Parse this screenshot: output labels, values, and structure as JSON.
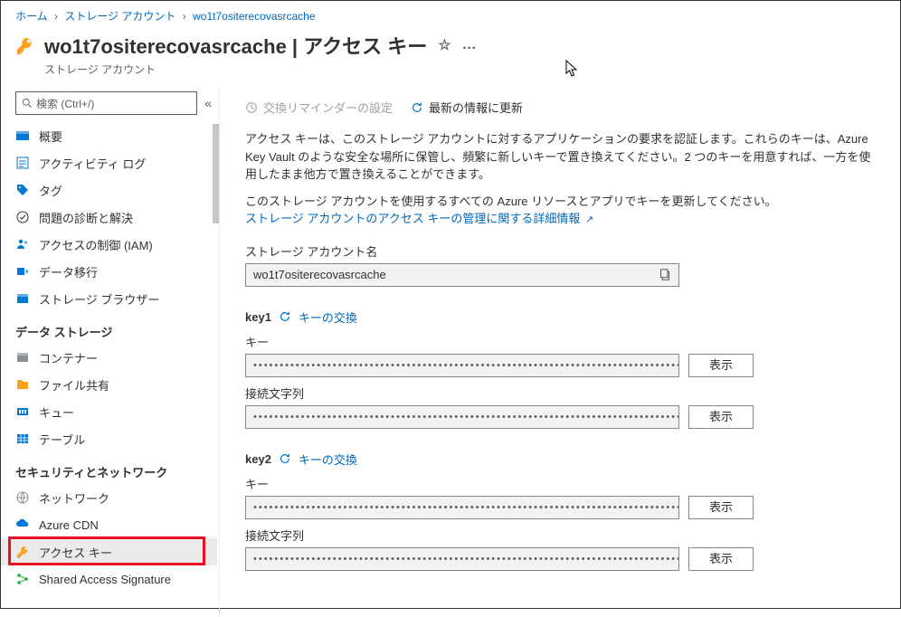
{
  "breadcrumb": {
    "home": "ホーム",
    "storage_accounts": "ストレージ アカウント",
    "current": "wo1t7ositerecovasrcache"
  },
  "header": {
    "title": "wo1t7ositerecovasrcache | アクセス キー",
    "subtitle": "ストレージ アカウント",
    "star": "☆",
    "more": "…"
  },
  "search": {
    "placeholder": "検索 (Ctrl+/)"
  },
  "nav": {
    "items": [
      {
        "label": "概要",
        "icon": "overview",
        "color": "#0078d4"
      },
      {
        "label": "アクティビティ ログ",
        "icon": "activity",
        "color": "#0078d4"
      },
      {
        "label": "タグ",
        "icon": "tag",
        "color": "#0078d4"
      },
      {
        "label": "問題の診断と解決",
        "icon": "diagnose",
        "color": "#323130"
      },
      {
        "label": "アクセスの制御 (IAM)",
        "icon": "iam",
        "color": "#0078d4"
      },
      {
        "label": "データ移行",
        "icon": "migrate",
        "color": "#0078d4"
      },
      {
        "label": "ストレージ ブラウザー",
        "icon": "browser",
        "color": "#0078d4"
      }
    ],
    "section_data": "データ ストレージ",
    "items_data": [
      {
        "label": "コンテナー",
        "icon": "container",
        "color": "#879092"
      },
      {
        "label": "ファイル共有",
        "icon": "fileshare",
        "color": "#faa21b"
      },
      {
        "label": "キュー",
        "icon": "queue",
        "color": "#0078d4"
      },
      {
        "label": "テーブル",
        "icon": "table",
        "color": "#0078d4"
      }
    ],
    "section_sec": "セキュリティとネットワーク",
    "items_sec": [
      {
        "label": "ネットワーク",
        "icon": "network",
        "color": "#879092"
      },
      {
        "label": "Azure CDN",
        "icon": "cdn",
        "color": "#0078d4"
      },
      {
        "label": "アクセス キー",
        "icon": "key",
        "color": "#faa21b",
        "selected": true
      },
      {
        "label": "Shared Access Signature",
        "icon": "sas",
        "color": "#1aab40"
      }
    ]
  },
  "toolbar": {
    "reminder": "交換リマインダーの設定",
    "refresh": "最新の情報に更新"
  },
  "content": {
    "desc1": "アクセス キーは、このストレージ アカウントに対するアプリケーションの要求を認証します。これらのキーは、Azure Key Vault のような安全な場所に保管し、頻繁に新しいキーで置き換えてください。2 つのキーを用意すれば、一方を使用したまま他方で置き換えることができます。",
    "desc2": "このストレージ アカウントを使用するすべての Azure リソースとアプリでキーを更新してください。",
    "doc_link": "ストレージ アカウントのアクセス キーの管理に関する詳細情報",
    "account_name_label": "ストレージ アカウント名",
    "account_name_value": "wo1t7ositerecovasrcache",
    "key_label": "キー",
    "conn_label": "接続文字列",
    "rotate_label": "キーの交換",
    "show_label": "表示",
    "secret_mask": "•••••••••••••••••••••••••••••••••••••••••••••••••••••••••••••••••••••••••••••••••••••••••••••••••••••••••••••••••••••••••••••",
    "key1_name": "key1",
    "key2_name": "key2"
  }
}
